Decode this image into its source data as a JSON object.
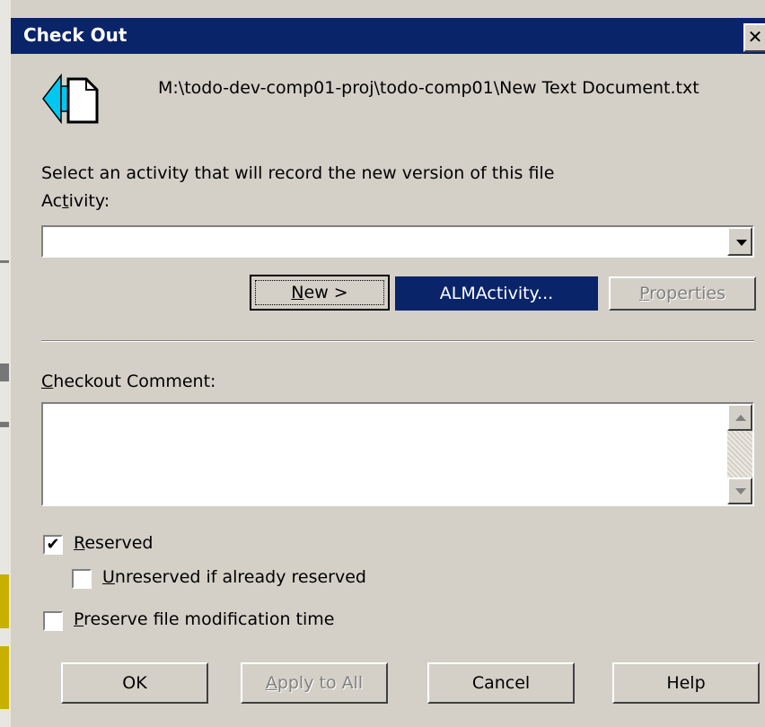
{
  "dialog": {
    "title": "Check Out",
    "close_glyph": "✕",
    "file_icon": "checkout-file-icon",
    "file_path": "M:\\todo-dev-comp01-proj\\todo-comp01\\New Text Document.txt",
    "prompt": "Select an activity that will record the new version of this file"
  },
  "activity": {
    "label_pre": "Ac",
    "label_key": "t",
    "label_post": "ivity:",
    "value": ""
  },
  "buttons_row": {
    "new_key": "N",
    "new_rest": "ew   >",
    "alm": "ALMActivity...",
    "properties_key": "P",
    "properties_rest": "roperties"
  },
  "comment": {
    "label_key": "C",
    "label_rest": "heckout Comment:",
    "value": ""
  },
  "options": {
    "reserved": {
      "key": "R",
      "rest": "eserved",
      "checked": true
    },
    "unreserved": {
      "key": "U",
      "rest": "nreserved if already reserved",
      "checked": false
    },
    "preserve": {
      "key": "P",
      "rest": "reserve file modification time",
      "checked": false
    }
  },
  "footer": {
    "ok": "OK",
    "apply_key": "A",
    "apply_rest": "pply to All",
    "cancel": "Cancel",
    "help": "Help"
  },
  "colors": {
    "titlebar": "#0a246a",
    "face": "#d4d0c8",
    "icon_arrow": "#00c8f0"
  }
}
